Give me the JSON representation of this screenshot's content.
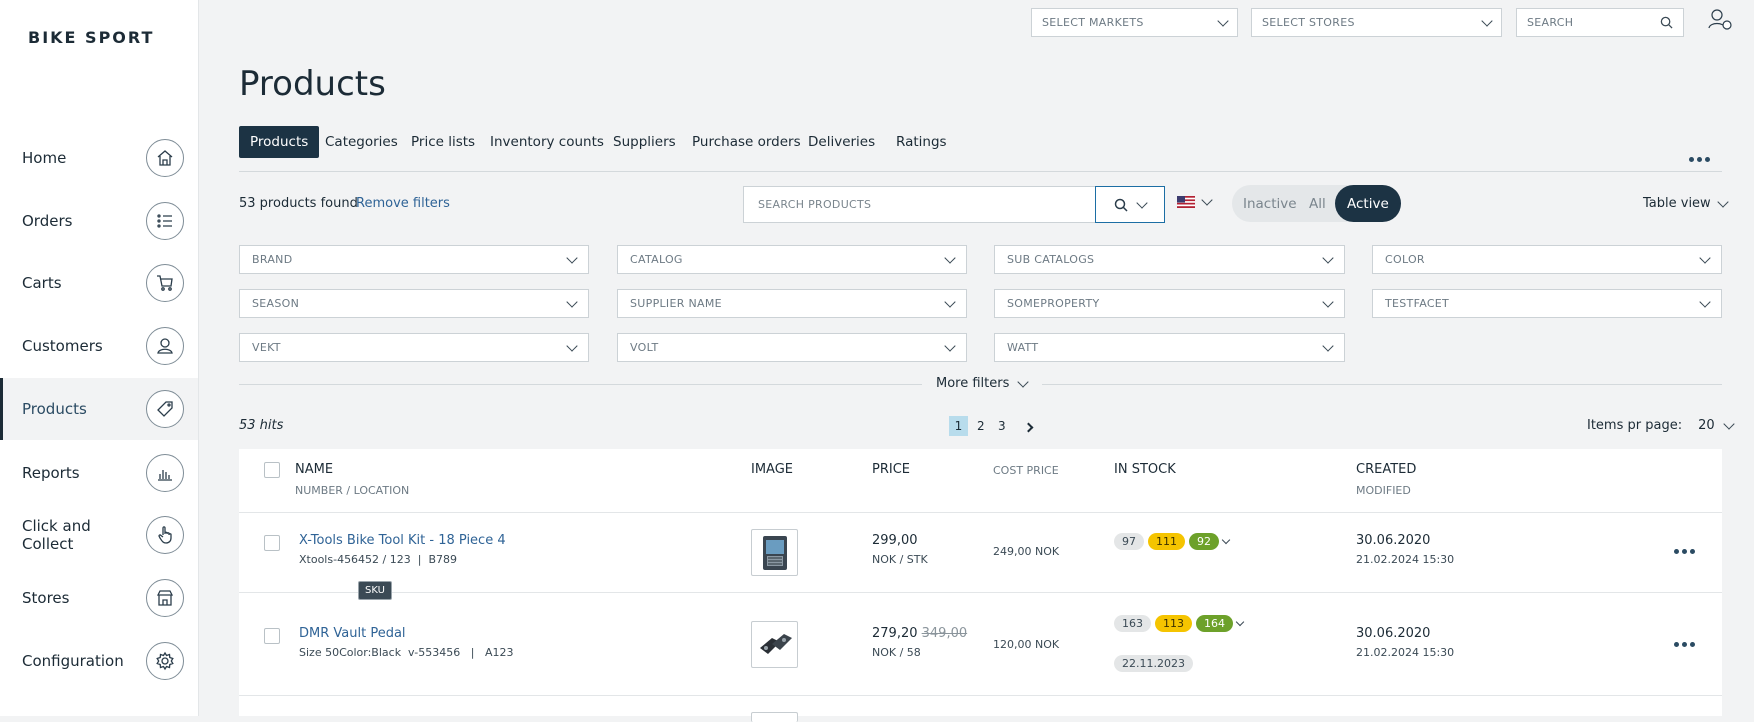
{
  "brand": "BIKE SPORT",
  "topbar": {
    "markets_placeholder": "SELECT MARKETS",
    "stores_placeholder": "SELECT STORES",
    "search_placeholder": "SEARCH"
  },
  "sidebar": {
    "items": [
      {
        "label": "Home",
        "icon": "home-icon"
      },
      {
        "label": "Orders",
        "icon": "list-icon"
      },
      {
        "label": "Carts",
        "icon": "cart-icon"
      },
      {
        "label": "Customers",
        "icon": "user-icon"
      },
      {
        "label": "Products",
        "icon": "tag-icon",
        "active": true
      },
      {
        "label": "Reports",
        "icon": "chart-icon"
      },
      {
        "label": "Click and Collect",
        "icon": "hand-pointer-icon"
      },
      {
        "label": "Stores",
        "icon": "store-icon"
      },
      {
        "label": "Configuration",
        "icon": "gear-icon"
      }
    ]
  },
  "page_title": "Products",
  "tabs": [
    "Products",
    "Categories",
    "Price lists",
    "Inventory counts",
    "Suppliers",
    "Purchase orders",
    "Deliveries",
    "Ratings"
  ],
  "toolbar": {
    "found": "53 products found",
    "remove_filters": "Remove filters",
    "search_placeholder": "SEARCH PRODUCTS",
    "seg_inactive": "Inactive",
    "seg_all": "All",
    "seg_active": "Active",
    "view": "Table view"
  },
  "filters": [
    "BRAND",
    "CATALOG",
    "SUB CATALOGS",
    "COLOR",
    "SEASON",
    "SUPPLIER NAME",
    "SOMEPROPERTY",
    "TESTFACET",
    "VEKT",
    "VOLT",
    "WATT"
  ],
  "more_filters": "More filters",
  "hits": "53 hits",
  "pagination": {
    "pages": [
      "1",
      "2",
      "3"
    ],
    "current": "1"
  },
  "items_per_page": {
    "label": "Items pr page:",
    "value": "20"
  },
  "table": {
    "headers": {
      "name": "NAME",
      "name_sub": "NUMBER / LOCATION",
      "image": "IMAGE",
      "price": "PRICE",
      "cost": "COST PRICE",
      "stock": "IN STOCK",
      "created": "CREATED",
      "modified": "MODIFIED"
    },
    "rows": [
      {
        "name": "X-Tools Bike Tool Kit - 18 Piece 4",
        "number": "Xtools-456452 / 123",
        "location": "B789",
        "price": "299,00",
        "price_unit": "NOK / STK",
        "cost": "249,00 NOK",
        "stock": [
          "97",
          "111",
          "92"
        ],
        "created": "30.06.2020",
        "modified": "21.02.2024 15:30"
      },
      {
        "name": "DMR Vault Pedal",
        "number": "Size 50Color:Black  v-553456",
        "location": "A123",
        "price": "279,20",
        "old_price": "349,00",
        "price_unit": "NOK / 58",
        "cost": "120,00 NOK",
        "stock": [
          "163",
          "113",
          "164"
        ],
        "stock_date": "22.11.2023",
        "created": "30.06.2020",
        "modified": "21.02.2024 15:30"
      }
    ]
  },
  "tooltip": "SKU",
  "colors": {
    "accent": "#1c3344",
    "link": "#2f6396",
    "yellow": "#f5c400",
    "green": "#6da12a"
  }
}
